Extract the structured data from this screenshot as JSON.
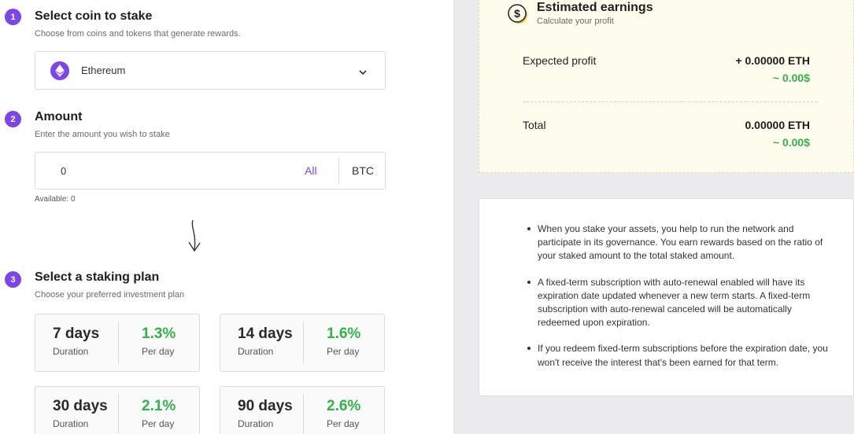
{
  "steps": [
    {
      "number": "1",
      "title": "Select coin to stake",
      "subtitle": "Choose from coins and tokens that generate rewards."
    },
    {
      "number": "2",
      "title": "Amount",
      "subtitle": "Enter the amount you wish to stake"
    },
    {
      "number": "3",
      "title": "Select a staking plan",
      "subtitle": "Choose your preferred investment plan"
    }
  ],
  "coin_select": {
    "value": "Ethereum",
    "icon": "ethereum-icon"
  },
  "amount": {
    "value": "0",
    "all_label": "All",
    "currency": "BTC",
    "available": "Available: 0"
  },
  "plans": [
    {
      "duration": "7 days",
      "duration_label": "Duration",
      "rate": "1.3%",
      "rate_label": "Per day"
    },
    {
      "duration": "14 days",
      "duration_label": "Duration",
      "rate": "1.6%",
      "rate_label": "Per day"
    },
    {
      "duration": "30 days",
      "duration_label": "Duration",
      "rate": "2.1%",
      "rate_label": "Per day"
    },
    {
      "duration": "90 days",
      "duration_label": "Duration",
      "rate": "2.6%",
      "rate_label": "Per day"
    }
  ],
  "earnings": {
    "title": "Estimated earnings",
    "subtitle": "Calculate your profit",
    "expected_label": "Expected profit",
    "expected_value": "+ 0.00000 ETH",
    "expected_usd": "~ 0.00$",
    "total_label": "Total",
    "total_value": "0.00000 ETH",
    "total_usd": "~ 0.00$"
  },
  "info": [
    "When you stake your assets, you help to run the network and participate in its governance. You earn rewards based on the ratio of your staked amount to the total staked amount.",
    "A fixed-term subscription with auto-renewal enabled will have its expiration date updated whenever a new term starts. A fixed-term subscription with auto-renewal canceled will be automatically redeemed upon expiration.",
    "If you redeem fixed-term subscriptions before the expiration date, you won't receive the interest that's been earned for that term."
  ],
  "colors": {
    "accent": "#7b45e8",
    "positive": "#33b24a",
    "earnings_bg": "#fefcec"
  }
}
